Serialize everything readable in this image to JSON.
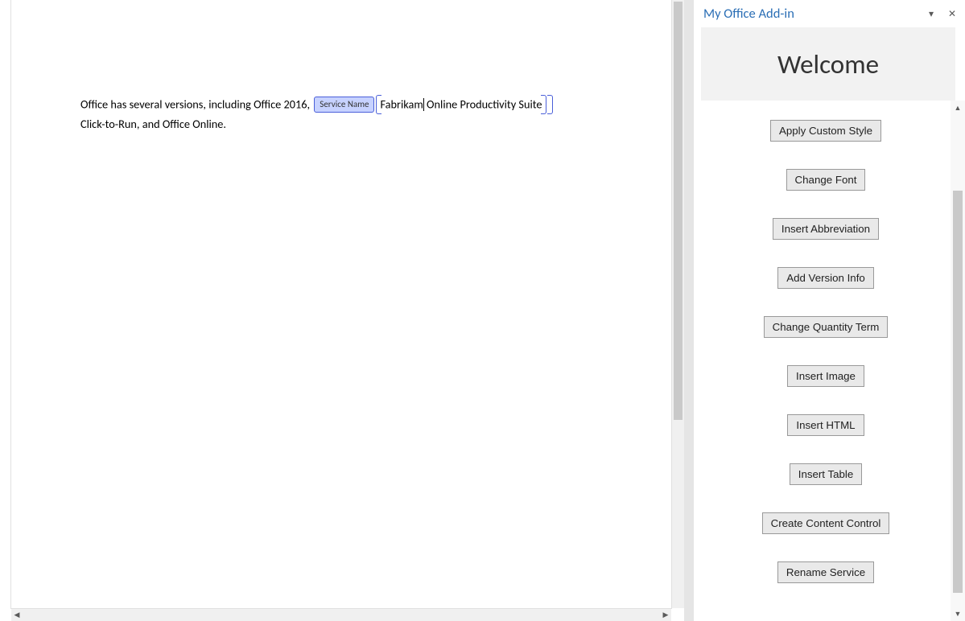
{
  "taskpane": {
    "title": "My Office Add-in",
    "welcome": "Welcome",
    "buttons": [
      "Apply Custom Style",
      "Change Font",
      "Insert Abbreviation",
      "Add Version Info",
      "Change Quantity Term",
      "Insert Image",
      "Insert HTML",
      "Insert Table",
      "Create Content Control",
      "Rename Service"
    ]
  },
  "document": {
    "text_before": "Office has several versions, including Office 2016, ",
    "content_control_tag": "Service Name",
    "cc_part1": "Fabrikam",
    "cc_part2": " Online Productivity Suite",
    "text_line2": "Click-to-Run, and Office Online."
  }
}
